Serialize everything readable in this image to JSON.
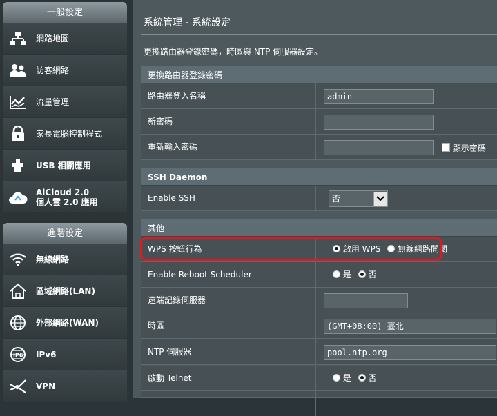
{
  "sidebar": {
    "general_header": "一般設定",
    "general_items": [
      {
        "label": "網路地圖",
        "icon": "network-map-icon"
      },
      {
        "label": "訪客網路",
        "icon": "guest-network-icon"
      },
      {
        "label": "流量管理",
        "icon": "traffic-manager-icon"
      },
      {
        "label": "家長電腦控制程式",
        "icon": "parental-control-icon"
      },
      {
        "label": "USB 相關應用",
        "icon": "usb-icon"
      },
      {
        "label": "AiCloud 2.0\n個人雲 2.0 應用",
        "icon": "aicloud-icon"
      }
    ],
    "advanced_header": "進階設定",
    "advanced_items": [
      {
        "label": "無線網路",
        "icon": "wireless-icon"
      },
      {
        "label": "區域網路(LAN)",
        "icon": "lan-icon"
      },
      {
        "label": "外部網路(WAN)",
        "icon": "wan-icon"
      },
      {
        "label": "IPv6",
        "icon": "ipv6-icon"
      },
      {
        "label": "VPN",
        "icon": "vpn-icon"
      }
    ]
  },
  "main": {
    "title": "系統管理 - 系統設定",
    "description": "更換路由器登錄密碼，時區與 NTP 伺服器設定。",
    "sections": {
      "password": "更換路由器登錄密碼",
      "ssh": "SSH Daemon",
      "misc": "其他"
    },
    "login_name": {
      "label": "路由器登入名稱",
      "value": "admin"
    },
    "new_password": {
      "label": "新密碼",
      "value": ""
    },
    "retype_password": {
      "label": "重新輸入密碼",
      "value": "",
      "show_label": "顯示密碼"
    },
    "enable_ssh": {
      "label": "Enable SSH",
      "value": "否"
    },
    "wps_button": {
      "label": "WPS 按鈕行為",
      "option1": "啟用 WPS",
      "option2": "無線網路開關"
    },
    "reboot_scheduler": {
      "label": "Enable Reboot Scheduler",
      "yes": "是",
      "no": "否"
    },
    "remote_log": {
      "label": "遠端記錄伺服器",
      "value": ""
    },
    "timezone": {
      "label": "時區",
      "value": "(GMT+08:00)  臺北"
    },
    "ntp_server": {
      "label": "NTP 伺服器",
      "value": "pool.ntp.org"
    },
    "telnet": {
      "label": "啟動 Telnet",
      "yes": "是",
      "no": "否"
    }
  },
  "colors": {
    "highlight": "#e8161c",
    "background": "#4d595d",
    "sidebar": "#2d3436"
  }
}
